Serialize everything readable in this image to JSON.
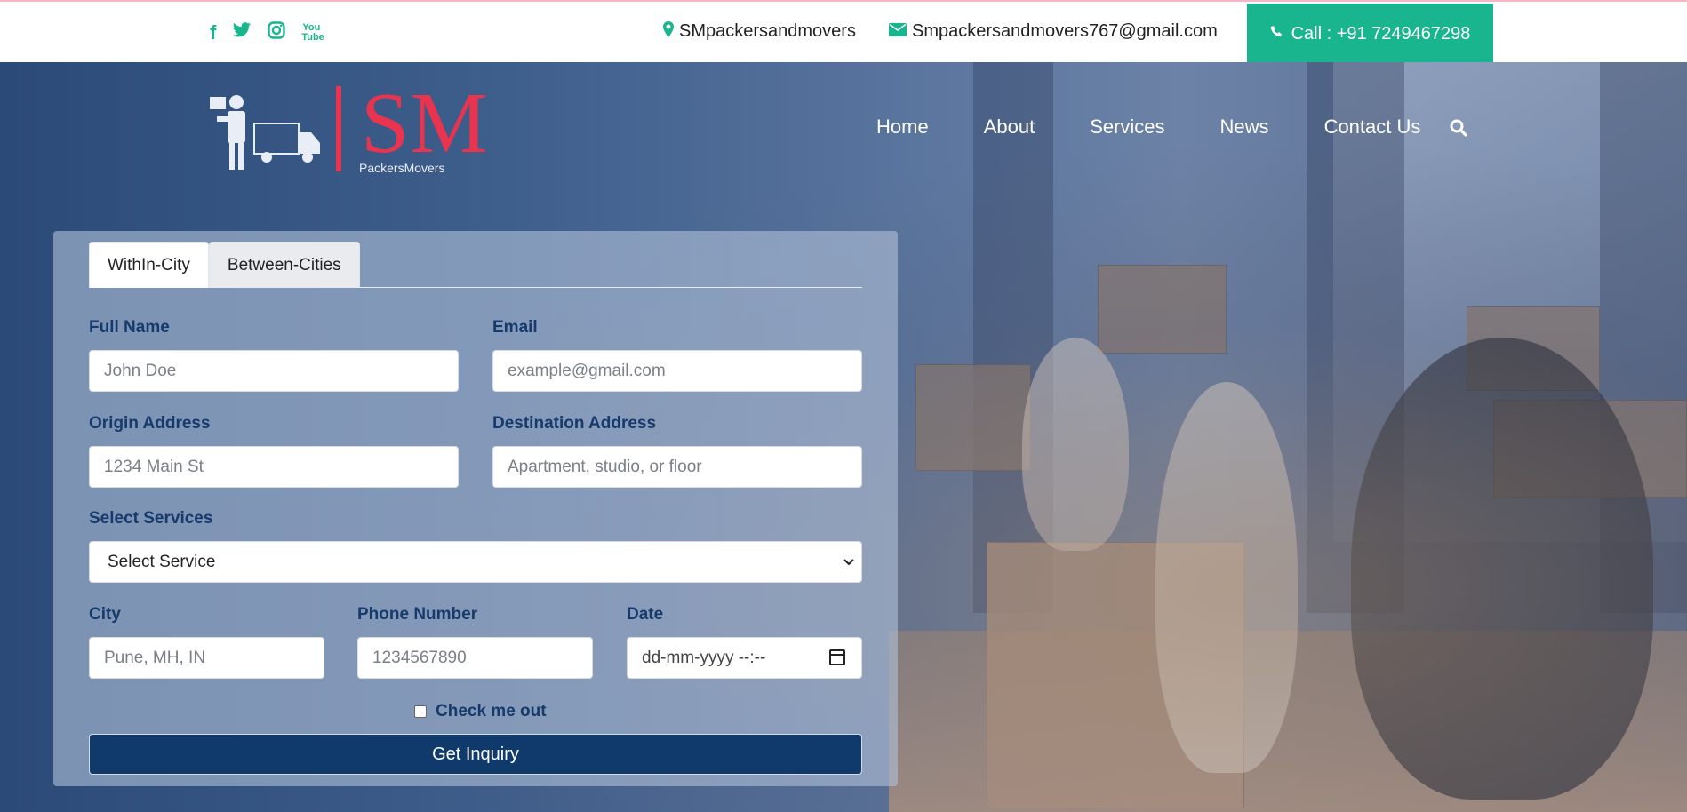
{
  "topbar": {
    "social_icons": [
      "facebook-icon",
      "twitter-icon",
      "instagram-icon",
      "youtube-icon"
    ],
    "youtube_text": "You\nTube",
    "address": "SMpackersandmovers",
    "email": "Smpackersandmovers767@gmail.com",
    "call_label": "Call : +91 7249467298"
  },
  "logo": {
    "initials": "SM",
    "subtitle": "PackersMovers"
  },
  "nav": {
    "items": [
      "Home",
      "About",
      "Services",
      "News",
      "Contact Us"
    ]
  },
  "form": {
    "tabs": [
      {
        "label": "WithIn-City",
        "active": true
      },
      {
        "label": "Between-Cities",
        "active": false
      }
    ],
    "full_name": {
      "label": "Full Name",
      "placeholder": "John Doe"
    },
    "email": {
      "label": "Email",
      "placeholder": "example@gmail.com"
    },
    "origin": {
      "label": "Origin Address",
      "placeholder": "1234 Main St"
    },
    "destination": {
      "label": "Destination Address",
      "placeholder": "Apartment, studio, or floor"
    },
    "services": {
      "label": "Select Services",
      "selected": "Select Service"
    },
    "city": {
      "label": "City",
      "placeholder": "Pune, MH, IN"
    },
    "phone": {
      "label": "Phone Number",
      "placeholder": "1234567890"
    },
    "date": {
      "label": "Date",
      "placeholder": "dd-mm-yyyy --:--"
    },
    "checkbox_label": "Check me out",
    "submit_label": "Get Inquiry"
  },
  "colors": {
    "accent_green": "#19b58e",
    "logo_red": "#e8344e",
    "navy": "#103a6c"
  }
}
